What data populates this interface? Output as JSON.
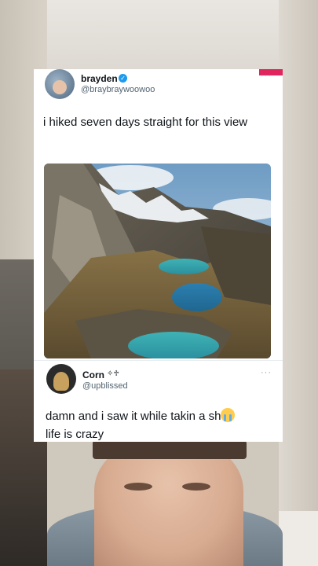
{
  "tweet": {
    "author_name": "brayden",
    "author_handle": "@braybraywoowoo",
    "text": "i hiked seven days straight for this view",
    "more_icon": "ellipsis-icon"
  },
  "reply": {
    "author_name": "Corn",
    "author_symbols": "✧♱",
    "author_handle": "@upblissed",
    "text_line1": "damn and i saw it while takin a sh",
    "text_line2": "life is crazy",
    "emoji": "crying-face-emoji"
  },
  "colors": {
    "verified": "#1d9bf0",
    "accent_tab": "#e0245e",
    "text": "#0f1419",
    "subtext": "#536471"
  }
}
